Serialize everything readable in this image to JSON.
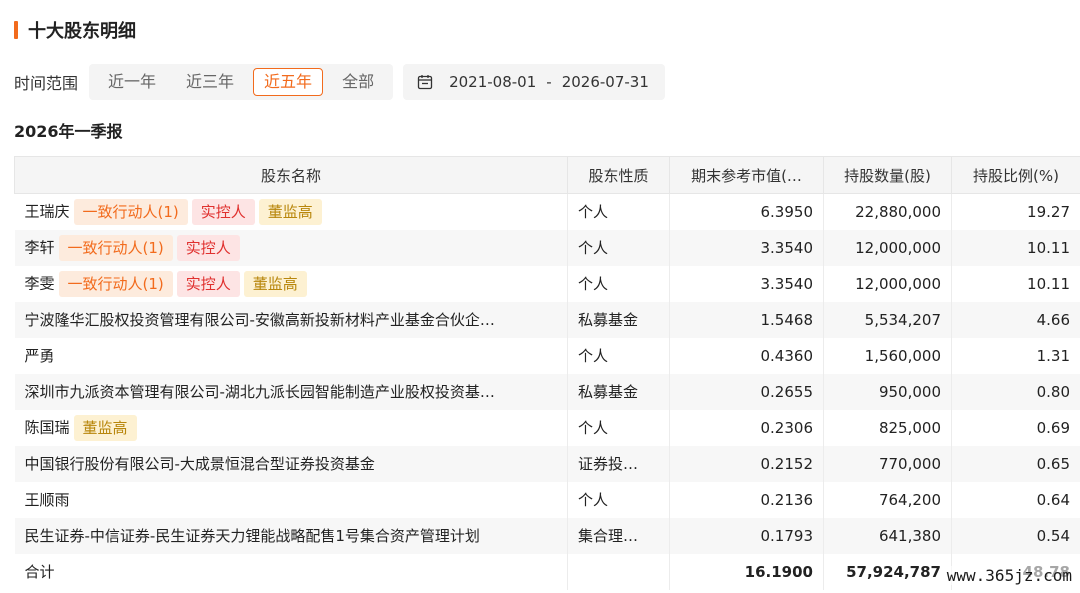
{
  "section_title": "十大股东明细",
  "range": {
    "label": "时间范围",
    "tabs": [
      "近一年",
      "近三年",
      "近五年",
      "全部"
    ],
    "active_index": 2,
    "start_date": "2021-08-01",
    "separator": "-",
    "end_date": "2026-07-31"
  },
  "report_title": "2026年一季报",
  "table": {
    "headers": [
      "股东名称",
      "股东性质",
      "期末参考市值(…",
      "持股数量(股)",
      "持股比例(%)"
    ],
    "rows": [
      {
        "name": "王瑞庆",
        "tags": [
          {
            "text": "一致行动人(1)",
            "color": "orange"
          },
          {
            "text": "实控人",
            "color": "red"
          },
          {
            "text": "董监高",
            "color": "yellow"
          }
        ],
        "type": "个人",
        "value": "6.3950",
        "shares": "22,880,000",
        "ratio": "19.27"
      },
      {
        "name": "李轩",
        "tags": [
          {
            "text": "一致行动人(1)",
            "color": "orange"
          },
          {
            "text": "实控人",
            "color": "red"
          }
        ],
        "type": "个人",
        "value": "3.3540",
        "shares": "12,000,000",
        "ratio": "10.11"
      },
      {
        "name": "李雯",
        "tags": [
          {
            "text": "一致行动人(1)",
            "color": "orange"
          },
          {
            "text": "实控人",
            "color": "red"
          },
          {
            "text": "董监高",
            "color": "yellow"
          }
        ],
        "type": "个人",
        "value": "3.3540",
        "shares": "12,000,000",
        "ratio": "10.11"
      },
      {
        "name": "宁波隆华汇股权投资管理有限公司-安徽高新投新材料产业基金合伙企…",
        "tags": [],
        "type": "私募基金",
        "value": "1.5468",
        "shares": "5,534,207",
        "ratio": "4.66"
      },
      {
        "name": "严勇",
        "tags": [],
        "type": "个人",
        "value": "0.4360",
        "shares": "1,560,000",
        "ratio": "1.31"
      },
      {
        "name": "深圳市九派资本管理有限公司-湖北九派长园智能制造产业股权投资基…",
        "tags": [],
        "type": "私募基金",
        "value": "0.2655",
        "shares": "950,000",
        "ratio": "0.80"
      },
      {
        "name": "陈国瑞",
        "tags": [
          {
            "text": "董监高",
            "color": "yellow"
          }
        ],
        "type": "个人",
        "value": "0.2306",
        "shares": "825,000",
        "ratio": "0.69"
      },
      {
        "name": "中国银行股份有限公司-大成景恒混合型证券投资基金",
        "tags": [],
        "type": "证券投…",
        "value": "0.2152",
        "shares": "770,000",
        "ratio": "0.65"
      },
      {
        "name": "王顺雨",
        "tags": [],
        "type": "个人",
        "value": "0.2136",
        "shares": "764,200",
        "ratio": "0.64"
      },
      {
        "name": "民生证券-中信证券-民生证券天力锂能战略配售1号集合资产管理计划",
        "tags": [],
        "type": "集合理…",
        "value": "0.1793",
        "shares": "641,380",
        "ratio": "0.54"
      }
    ],
    "total": {
      "label": "合计",
      "value": "16.1900",
      "shares": "57,924,787",
      "ratio": "48.78"
    }
  },
  "watermark": "www.365jz.com",
  "colors": {
    "accent": "#f26b1d"
  }
}
